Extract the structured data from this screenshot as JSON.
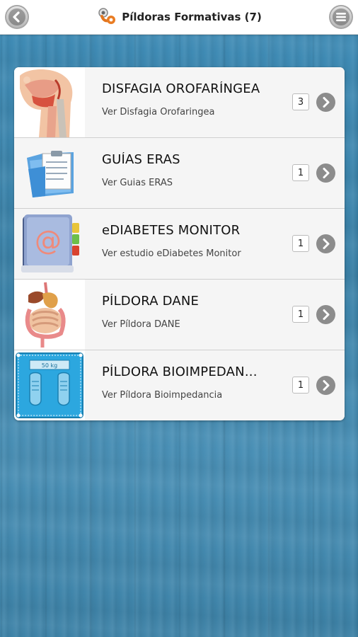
{
  "header": {
    "title": "Píldoras Formativas (7)",
    "back_icon": "back-arrow-icon",
    "menu_icon": "menu-icon",
    "logo_icon": "app-logo-icon"
  },
  "items": [
    {
      "title": "DISFAGIA OROFARÍNGEA",
      "subtitle": "Ver Disfagia Orofaringea",
      "count": "3",
      "thumb_icon": "throat-anatomy-icon"
    },
    {
      "title": "GUÍAS ERAS",
      "subtitle": "Ver Guias ERAS",
      "count": "1",
      "thumb_icon": "folder-clipboard-icon"
    },
    {
      "title": "eDIABETES MONITOR",
      "subtitle": "Ver estudio eDiabetes Monitor",
      "count": "1",
      "thumb_icon": "address-book-icon"
    },
    {
      "title": "PÍLDORA DANE",
      "subtitle": "Ver Píldora DANE",
      "count": "1",
      "thumb_icon": "digestive-system-icon"
    },
    {
      "title": "PÍLDORA BIOIMPEDAN...",
      "subtitle": "Ver Píldora Bioimpedancia",
      "count": "1",
      "thumb_icon": "bathroom-scale-icon",
      "scale_display": "50 kg"
    }
  ],
  "colors": {
    "background": "#3f86ad",
    "chevron": "#8c8c8c"
  }
}
